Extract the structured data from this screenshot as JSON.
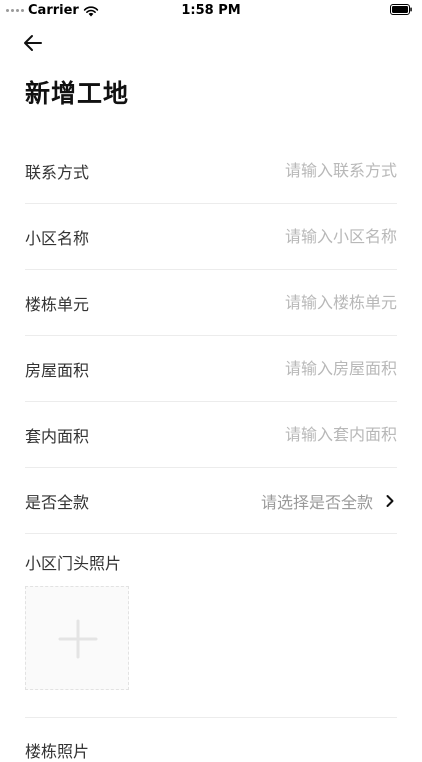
{
  "status_bar": {
    "carrier": "Carrier",
    "time": "1:58 PM"
  },
  "header": {
    "title": "新增工地"
  },
  "form": {
    "rows": [
      {
        "label": "联系方式",
        "placeholder": "请输入联系方式"
      },
      {
        "label": "小区名称",
        "placeholder": "请输入小区名称"
      },
      {
        "label": "楼栋单元",
        "placeholder": "请输入楼栋单元"
      },
      {
        "label": "房屋面积",
        "placeholder": "请输入房屋面积"
      },
      {
        "label": "套内面积",
        "placeholder": "请输入套内面积"
      }
    ],
    "select": {
      "label": "是否全款",
      "placeholder": "请选择是否全款"
    }
  },
  "photos": {
    "section_1_label": "小区门头照片",
    "section_2_label": "楼栋照片"
  },
  "icons": [
    "back-arrow-icon",
    "chevron-right-icon",
    "plus-icon",
    "wifi-icon",
    "battery-icon"
  ]
}
